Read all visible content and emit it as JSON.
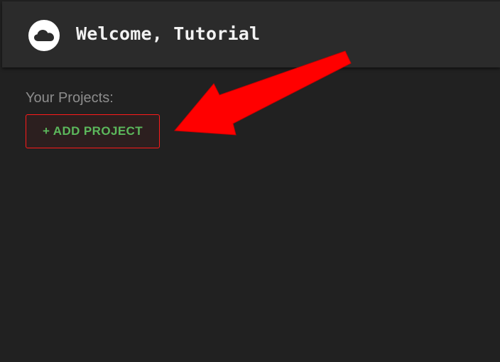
{
  "header": {
    "welcome_text": "Welcome, Tutorial",
    "logo_icon": "cloud-icon"
  },
  "main": {
    "projects_label": "Your Projects:",
    "add_project_label": "+ ADD PROJECT"
  },
  "annotation": {
    "arrow_icon": "arrow-pointer-icon",
    "arrow_color": "#ff0000"
  },
  "colors": {
    "background": "#212121",
    "header_background": "#2b2b2b",
    "button_text": "#5cb85c",
    "button_border": "#ff1a1a"
  }
}
